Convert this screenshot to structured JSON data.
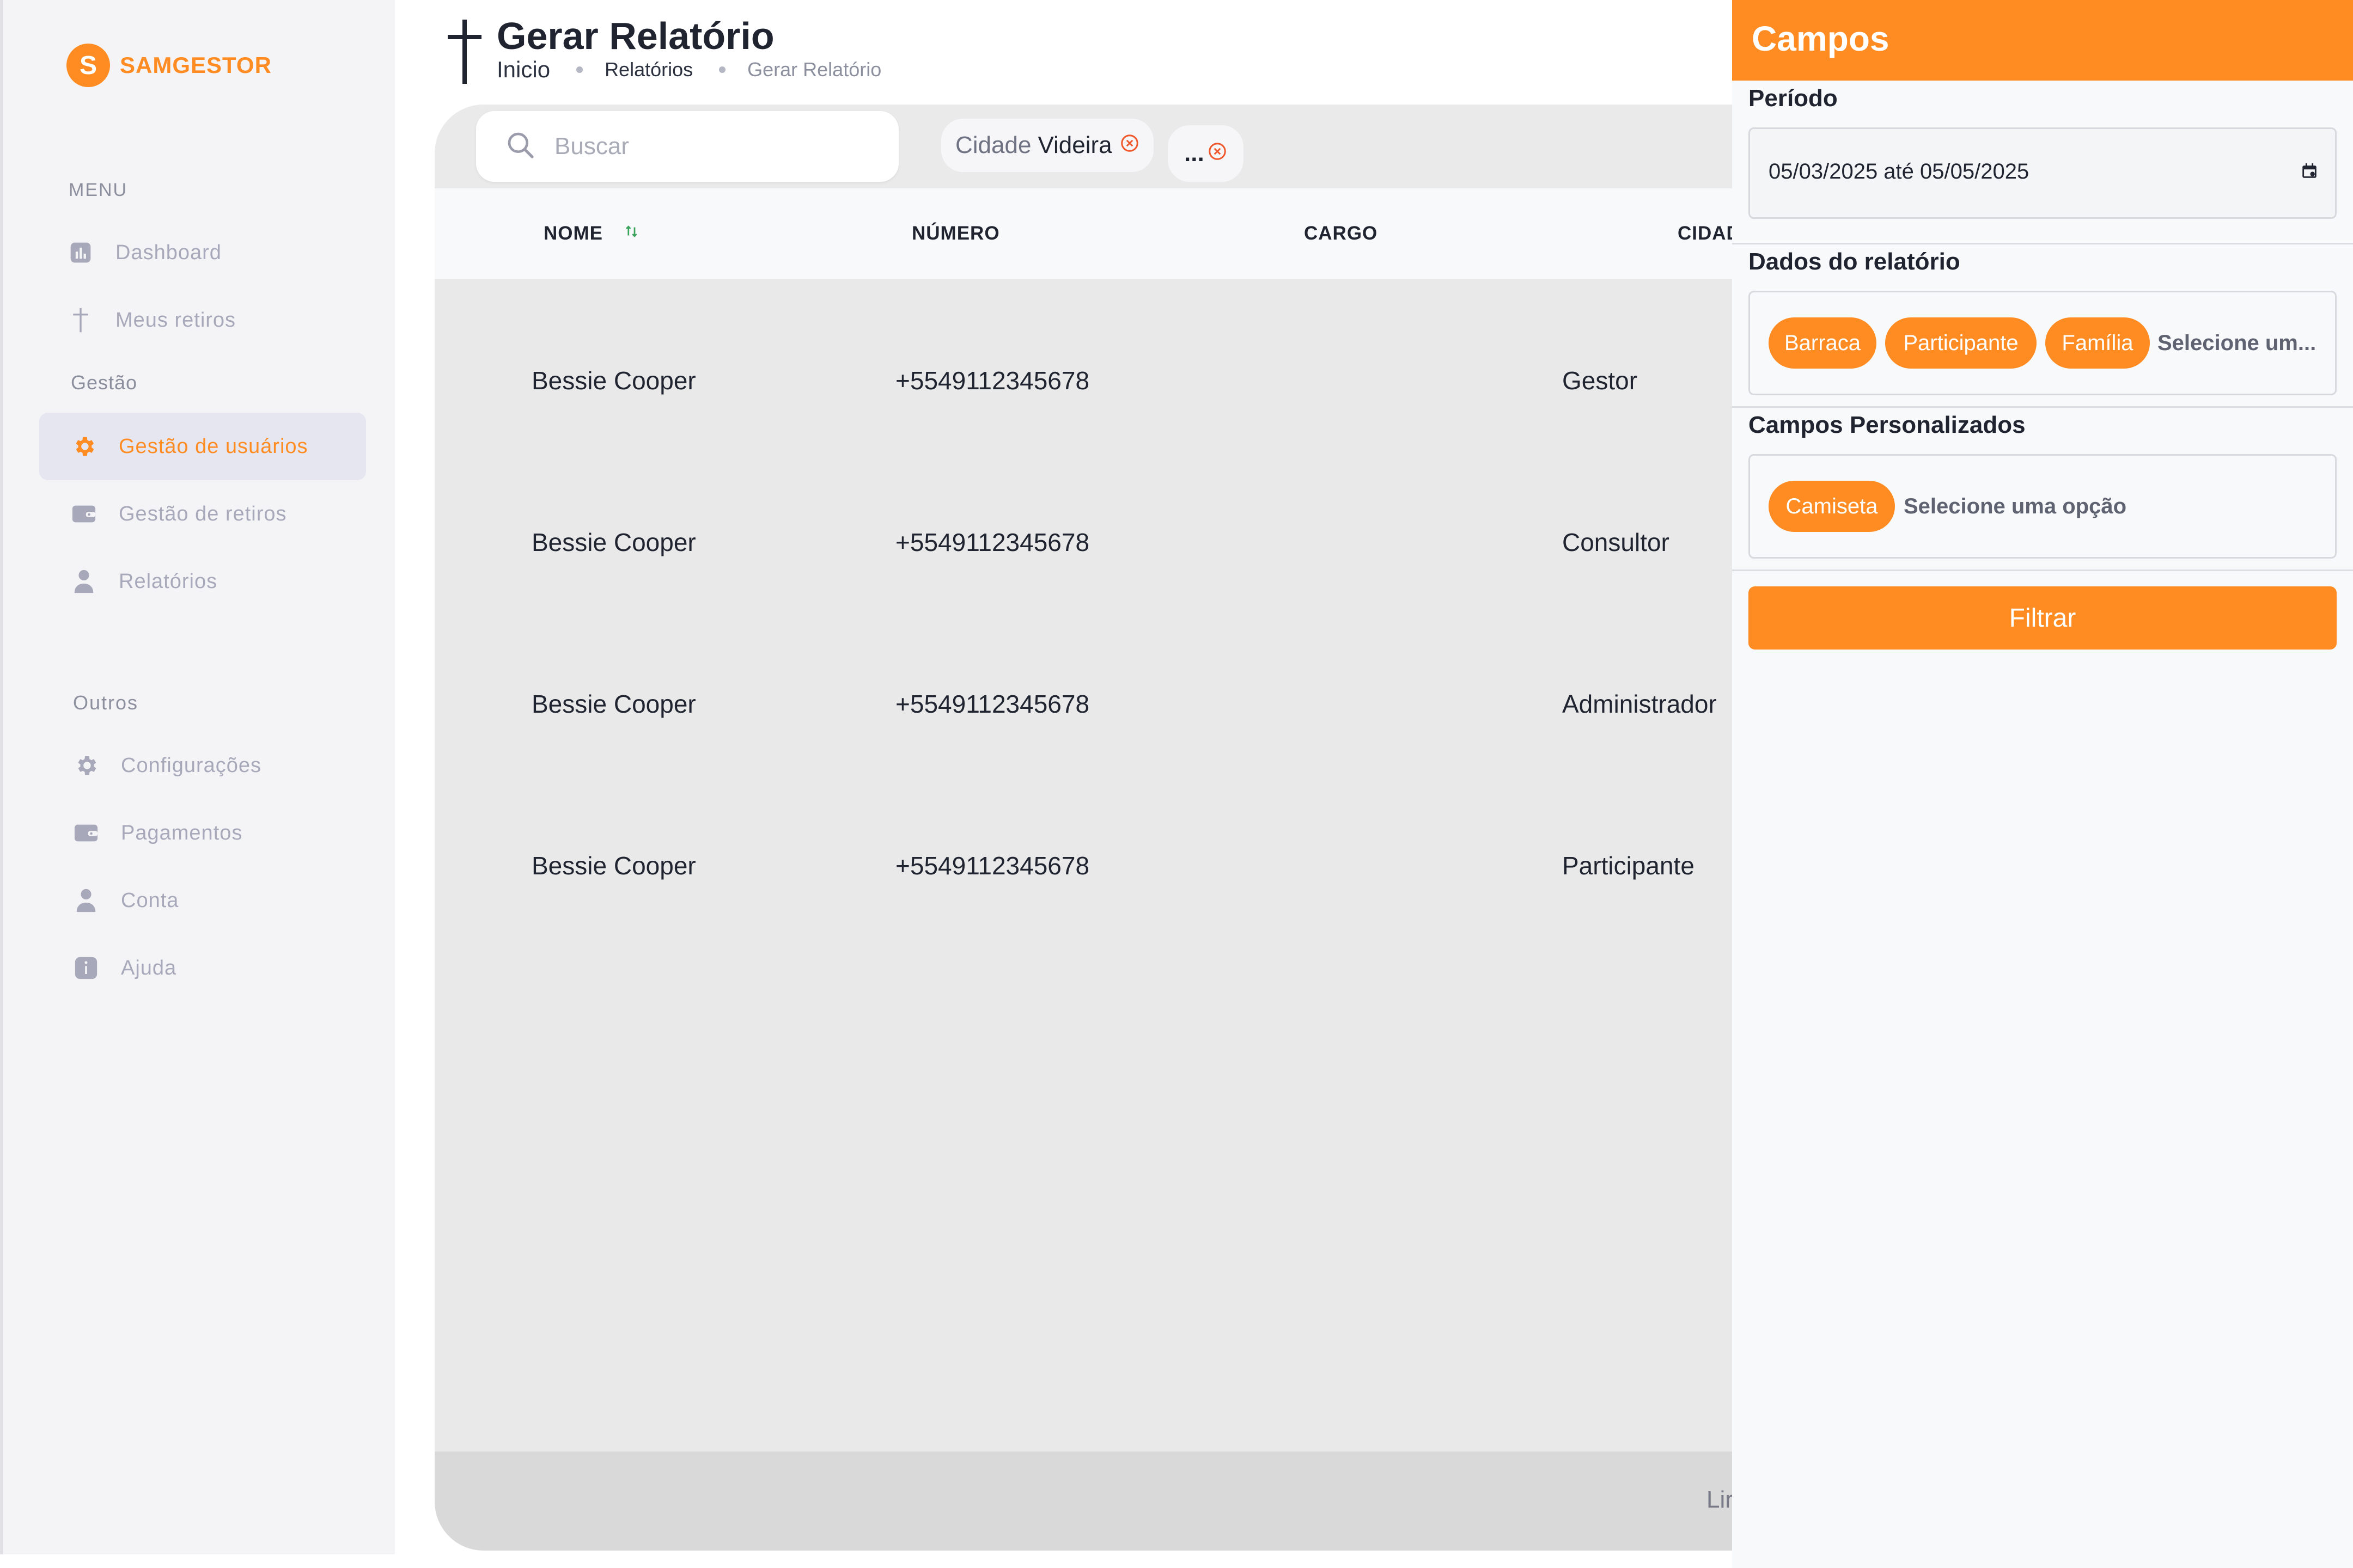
{
  "brand": {
    "logo_letter": "S",
    "name": "SAMGESTOR"
  },
  "sidebar": {
    "menu_label": "MENU",
    "gestao_label": "Gestão",
    "outros_label": "Outros",
    "items": [
      {
        "label": "Dashboard",
        "icon": "chart-icon"
      },
      {
        "label": "Meus retiros",
        "icon": "cross-icon"
      },
      {
        "label": "Gestão de usuários",
        "icon": "gear-icon",
        "active": true
      },
      {
        "label": "Gestão de retiros",
        "icon": "wallet-icon"
      },
      {
        "label": "Relatórios",
        "icon": "user-icon"
      },
      {
        "label": "Configurações",
        "icon": "gear-icon"
      },
      {
        "label": "Pagamentos",
        "icon": "wallet-icon"
      },
      {
        "label": "Conta",
        "icon": "user-icon"
      },
      {
        "label": "Ajuda",
        "icon": "info-icon"
      }
    ]
  },
  "header": {
    "title": "Gerar Relatório",
    "breadcrumb": [
      "Inicio",
      "Relatórios",
      "Gerar Relatório"
    ]
  },
  "search": {
    "placeholder": "Buscar"
  },
  "filters": [
    {
      "key": "Cidade",
      "value": "Videira"
    },
    {
      "key": "",
      "value": "..."
    }
  ],
  "table": {
    "columns": [
      "NOME",
      "NÚMERO",
      "CARGO",
      "CIDAD"
    ],
    "rows": [
      {
        "nome": "Bessie Cooper",
        "numero": "+5549112345678",
        "cargo": "",
        "cidade": "Gestor"
      },
      {
        "nome": "Bessie Cooper",
        "numero": "+5549112345678",
        "cargo": "",
        "cidade": "Consultor"
      },
      {
        "nome": "Bessie Cooper",
        "numero": "+5549112345678",
        "cargo": "",
        "cidade": "Administrador"
      },
      {
        "nome": "Bessie Cooper",
        "numero": "+5549112345678",
        "cargo": "",
        "cidade": "Participante"
      }
    ],
    "footer_text": "Lir"
  },
  "drawer": {
    "title": "Campos",
    "periodo_label": "Período",
    "periodo_value": "05/03/2025 até 05/05/2025",
    "dados_label": "Dados do relatório",
    "dados_tags": [
      "Barraca",
      "Participante",
      "Família"
    ],
    "dados_placeholder": "Selecione um...",
    "campos_label": "Campos Personalizados",
    "campos_tags": [
      "Camiseta"
    ],
    "campos_placeholder": "Selecione uma opção",
    "filter_button": "Filtrar"
  },
  "colors": {
    "accent": "#ff8c22",
    "sidebar_bg": "#f4f4f6",
    "table_body": "#e9e9e9",
    "sidebar_text": "#a7a9bb"
  }
}
